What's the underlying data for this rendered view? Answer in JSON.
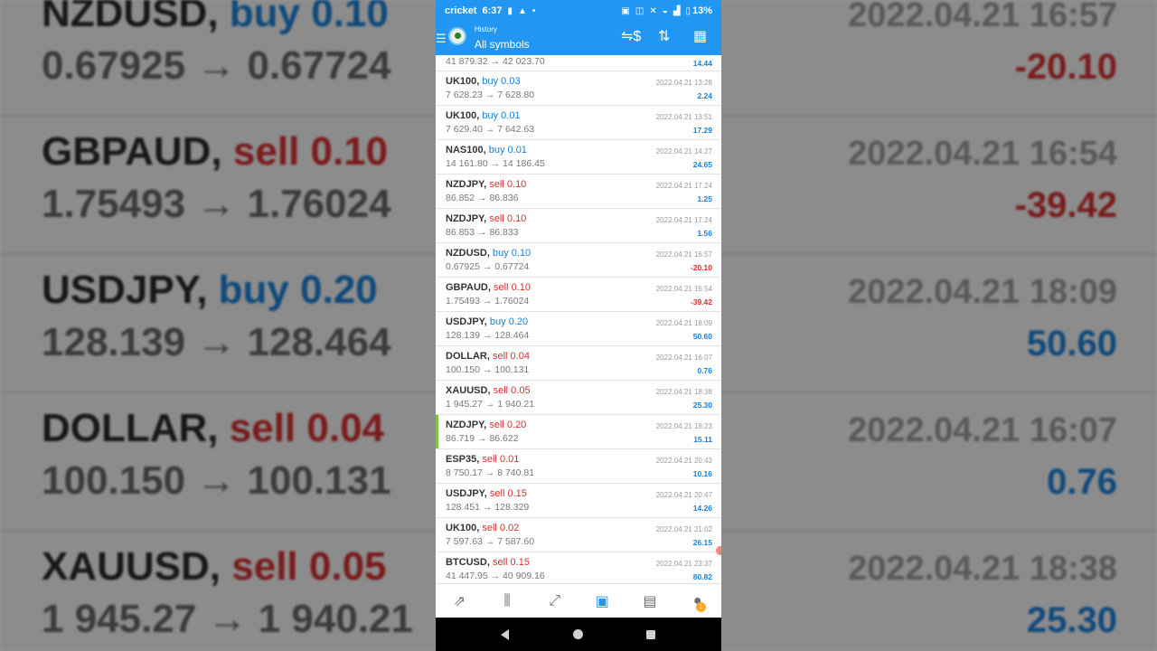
{
  "background": {
    "rows": [
      {
        "symbol": "NZDUSD,",
        "direction": "buy",
        "volume": "0.10",
        "prices": "0.67925 → 0.67724",
        "date": "2022.04.21 16:57",
        "profit": "-20.10",
        "profit_sign": "neg"
      },
      {
        "symbol": "GBPAUD,",
        "direction": "sell",
        "volume": "0.10",
        "prices": "1.75493 → 1.76024",
        "date": "2022.04.21 16:54",
        "profit": "-39.42",
        "profit_sign": "neg"
      },
      {
        "symbol": "USDJPY,",
        "direction": "buy",
        "volume": "0.20",
        "prices": "128.139 → 128.464",
        "date": "2022.04.21 18:09",
        "profit": "50.60",
        "profit_sign": "pos"
      },
      {
        "symbol": "DOLLAR,",
        "direction": "sell",
        "volume": "0.04",
        "prices": "100.150 → 100.131",
        "date": "2022.04.21 16:07",
        "profit": "0.76",
        "profit_sign": "pos"
      },
      {
        "symbol": "XAUUSD,",
        "direction": "sell",
        "volume": "0.05",
        "prices": "1 945.27 → 1 940.21",
        "date": "2022.04.21 18:38",
        "profit": "25.30",
        "profit_sign": "pos"
      }
    ]
  },
  "status_bar": {
    "carrier": "cricket",
    "time": "6:37",
    "battery": "13%",
    "icons": [
      "battery-icon",
      "warning-icon",
      "dot-icon",
      "nfc-icon",
      "cast-icon",
      "mute-icon",
      "wifi-icon",
      "signal-icon"
    ]
  },
  "header": {
    "subtitle": "History",
    "title": "All symbols",
    "actions": [
      "currency-filter-icon",
      "sort-icon",
      "calendar-icon"
    ]
  },
  "first_row": {
    "prices": "41 879.32 → 42 023.70",
    "profit": "14.44"
  },
  "deals": [
    {
      "symbol": "UK100,",
      "direction": "buy",
      "volume": "0.03",
      "prices": "7 628.23 → 7 628.80",
      "date": "2022.04.21 13:28",
      "profit": "2.24",
      "profit_sign": "pos"
    },
    {
      "symbol": "UK100,",
      "direction": "buy",
      "volume": "0.01",
      "prices": "7 629.40 → 7 642.63",
      "date": "2022.04.21 13:51",
      "profit": "17.29",
      "profit_sign": "pos"
    },
    {
      "symbol": "NAS100,",
      "direction": "buy",
      "volume": "0.01",
      "prices": "14 161.80 → 14 186.45",
      "date": "2022.04.21 14:27",
      "profit": "24.65",
      "profit_sign": "pos"
    },
    {
      "symbol": "NZDJPY,",
      "direction": "sell",
      "volume": "0.10",
      "prices": "86.852 → 86.836",
      "date": "2022.04.21 17:24",
      "profit": "1.25",
      "profit_sign": "pos"
    },
    {
      "symbol": "NZDJPY,",
      "direction": "sell",
      "volume": "0.10",
      "prices": "86.853 → 86.833",
      "date": "2022.04.21 17:24",
      "profit": "1.56",
      "profit_sign": "pos"
    },
    {
      "symbol": "NZDUSD,",
      "direction": "buy",
      "volume": "0.10",
      "prices": "0.67925 → 0.67724",
      "date": "2022.04.21 16:57",
      "profit": "-20.10",
      "profit_sign": "neg"
    },
    {
      "symbol": "GBPAUD,",
      "direction": "sell",
      "volume": "0.10",
      "prices": "1.75493 → 1.76024",
      "date": "2022.04.21 16:54",
      "profit": "-39.42",
      "profit_sign": "neg"
    },
    {
      "symbol": "USDJPY,",
      "direction": "buy",
      "volume": "0.20",
      "prices": "128.139 → 128.464",
      "date": "2022.04.21 18:09",
      "profit": "50.60",
      "profit_sign": "pos"
    },
    {
      "symbol": "DOLLAR,",
      "direction": "sell",
      "volume": "0.04",
      "prices": "100.150 → 100.131",
      "date": "2022.04.21 16:07",
      "profit": "0.76",
      "profit_sign": "pos"
    },
    {
      "symbol": "XAUUSD,",
      "direction": "sell",
      "volume": "0.05",
      "prices": "1 945.27 → 1 940.21",
      "date": "2022.04.21 18:38",
      "profit": "25.30",
      "profit_sign": "pos"
    },
    {
      "symbol": "NZDJPY,",
      "direction": "sell",
      "volume": "0.20",
      "prices": "86.719 → 86.622",
      "date": "2022.04.21 18:23",
      "profit": "15.11",
      "profit_sign": "pos",
      "highlighted": true
    },
    {
      "symbol": "ESP35,",
      "direction": "sell",
      "volume": "0.01",
      "prices": "8 750.17 → 8 740.81",
      "date": "2022.04.21 20:43",
      "profit": "10.16",
      "profit_sign": "pos"
    },
    {
      "symbol": "USDJPY,",
      "direction": "sell",
      "volume": "0.15",
      "prices": "128.451 → 128.329",
      "date": "2022.04.21 20:47",
      "profit": "14.26",
      "profit_sign": "pos"
    },
    {
      "symbol": "UK100,",
      "direction": "sell",
      "volume": "0.02",
      "prices": "7 597.63 → 7 587.60",
      "date": "2022.04.21 21:02",
      "profit": "26.15",
      "profit_sign": "pos"
    },
    {
      "symbol": "BTCUSD,",
      "direction": "sell",
      "volume": "0.15",
      "prices": "41 447.95 → 40 909.16",
      "date": "2022.04.21 23:37",
      "profit": "80.82",
      "profit_sign": "pos"
    }
  ],
  "bottom_nav": {
    "items": [
      {
        "icon": "quotes-icon",
        "glyph": "⇗"
      },
      {
        "icon": "chart-candles-icon",
        "glyph": "⫼"
      },
      {
        "icon": "trade-icon",
        "glyph": "⤢"
      },
      {
        "icon": "history-icon",
        "glyph": "▣",
        "active": true
      },
      {
        "icon": "news-icon",
        "glyph": "▤"
      },
      {
        "icon": "messages-icon",
        "glyph": "●",
        "badge": "1"
      }
    ]
  },
  "colors": {
    "app_bar": "#2196f3",
    "buy": "#1a7fd4",
    "sell": "#d32f2f",
    "highlight": "#7cc142"
  }
}
